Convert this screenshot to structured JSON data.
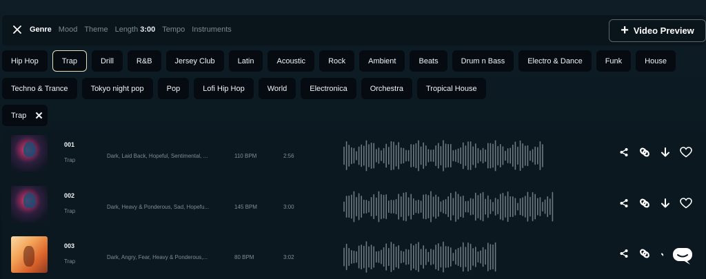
{
  "topbar": {
    "tabs": [
      {
        "label": "Genre",
        "active": true
      },
      {
        "label": "Mood",
        "active": false
      },
      {
        "label": "Theme",
        "active": false
      },
      {
        "label": "Length",
        "active": false,
        "value": "3:00"
      },
      {
        "label": "Tempo",
        "active": false
      },
      {
        "label": "Instruments",
        "active": false
      }
    ],
    "video_preview_label": "Video Preview"
  },
  "genres_row1": [
    "Hip Hop",
    "Trap",
    "Drill",
    "R&B",
    "Jersey Club",
    "Latin",
    "Acoustic",
    "Rock",
    "Ambient",
    "Beats",
    "Drum n Bass",
    "Electro & Dance",
    "Funk",
    "House"
  ],
  "genres_row2": [
    "Techno & Trance",
    "Tokyo night pop",
    "Pop",
    "Lofi Hip Hop",
    "World",
    "Electronica",
    "Orchestra",
    "Tropical House"
  ],
  "selected_genre": "Trap",
  "active_filter": {
    "label": "Trap"
  },
  "tracks": [
    {
      "number": "001",
      "genre": "Trap",
      "moods": "Dark, Laid Back, Hopeful, Sentimental, ...",
      "bpm": "110 BPM",
      "duration": "2:56",
      "cover": "dark"
    },
    {
      "number": "002",
      "genre": "Trap",
      "moods": "Dark, Heavy & Ponderous, Sad, Hopefu...",
      "bpm": "145 BPM",
      "duration": "3:00",
      "cover": "dark"
    },
    {
      "number": "003",
      "genre": "Trap",
      "moods": "Dark, Angry, Fear, Heavy & Ponderous,...",
      "bpm": "80 BPM",
      "duration": "3:02",
      "cover": "warm"
    }
  ],
  "icons": {
    "close": "close-icon",
    "plus": "plus-icon",
    "share": "share-icon",
    "link": "link-icon",
    "download": "download-icon",
    "like": "heart-icon",
    "chat": "chat-icon"
  },
  "colors": {
    "background": "#0e1d26",
    "chip_bg": "#050b10",
    "selected_border": "#e6e3b8",
    "waveform": "#6f7a82"
  }
}
